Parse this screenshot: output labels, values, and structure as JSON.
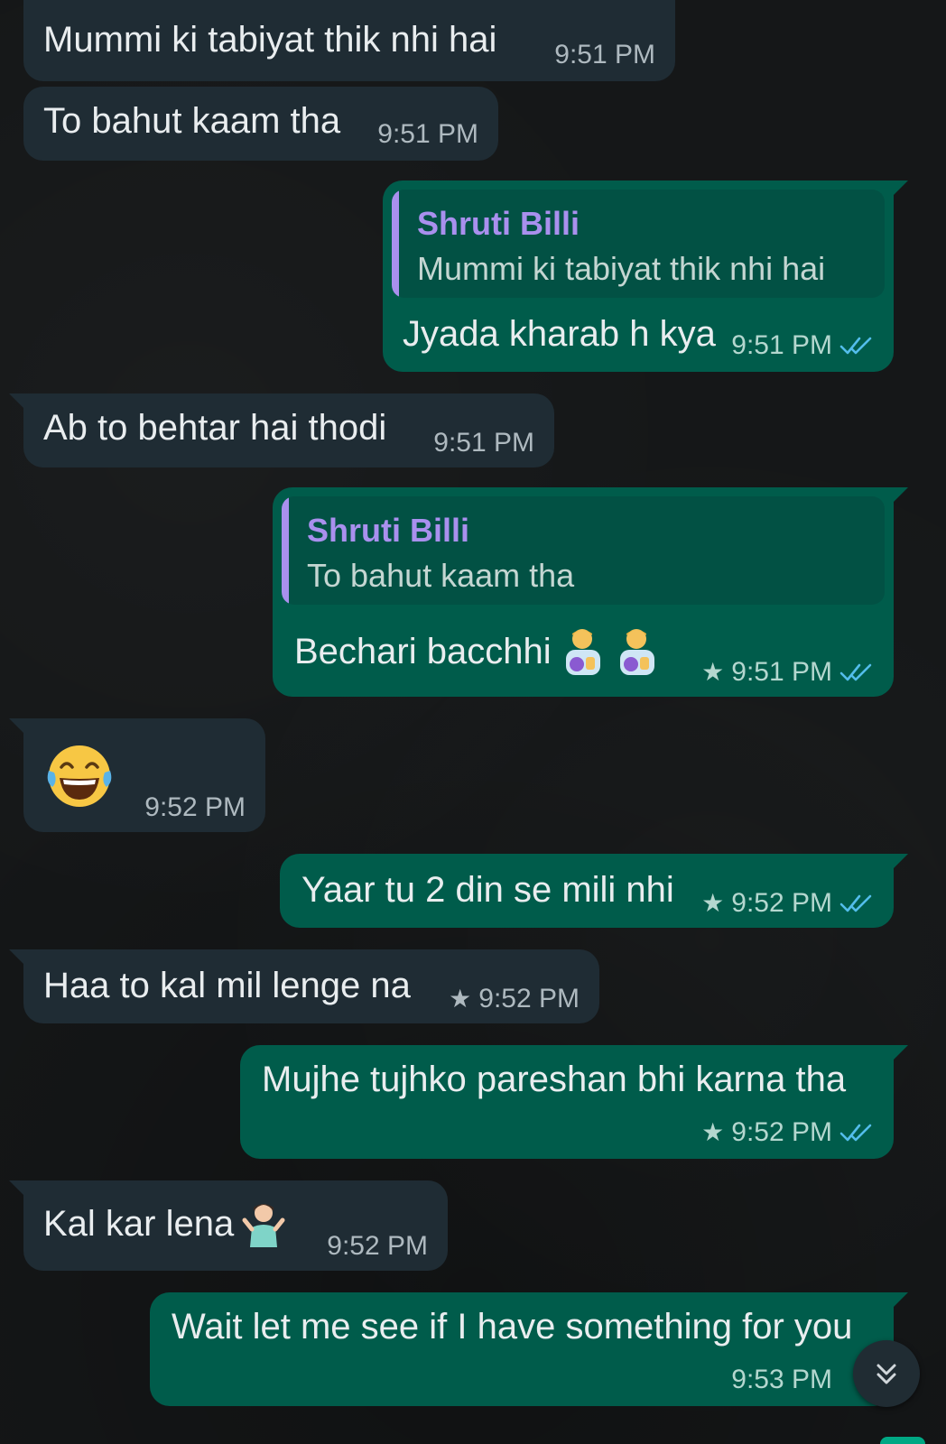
{
  "messages": [
    {
      "text": "Mummi ki tabiyat thik nhi hai",
      "time": "9:51 PM"
    },
    {
      "text": "To bahut kaam tha",
      "time": "9:51 PM"
    },
    {
      "quote_name": "Shruti Billi",
      "quote_text": "Mummi ki tabiyat thik nhi hai",
      "text": "Jyada kharab h kya",
      "time": "9:51 PM"
    },
    {
      "text": "Ab to behtar hai thodi",
      "time": "9:51 PM"
    },
    {
      "quote_name": "Shruti Billi",
      "quote_text": "To bahut kaam tha",
      "text": "Bechari bacchhi",
      "time": "9:51 PM",
      "starred": true
    },
    {
      "emoji": "face-with-tears-of-joy",
      "time": "9:52 PM"
    },
    {
      "text": "Yaar tu 2 din se mili nhi",
      "time": "9:52 PM",
      "starred": true
    },
    {
      "text": "Haa to kal mil lenge na",
      "time": "9:52 PM",
      "starred": true
    },
    {
      "text": "Mujhe tujhko pareshan bhi karna tha",
      "time": "9:52 PM",
      "starred": true
    },
    {
      "text": "Kal kar lena",
      "time": "9:52 PM"
    },
    {
      "text": "Wait let me see if I have something for you",
      "time": "9:53 PM"
    }
  ],
  "icons": {
    "star": "★",
    "read_receipt": "double-check-icon",
    "scroll_down": "double-chevron-down-icon"
  },
  "colors": {
    "incoming_bubble": "#1f2c34",
    "outgoing_bubble": "#005c4b",
    "quote_name": "#a990ee",
    "read_tick": "#53bdeb"
  }
}
